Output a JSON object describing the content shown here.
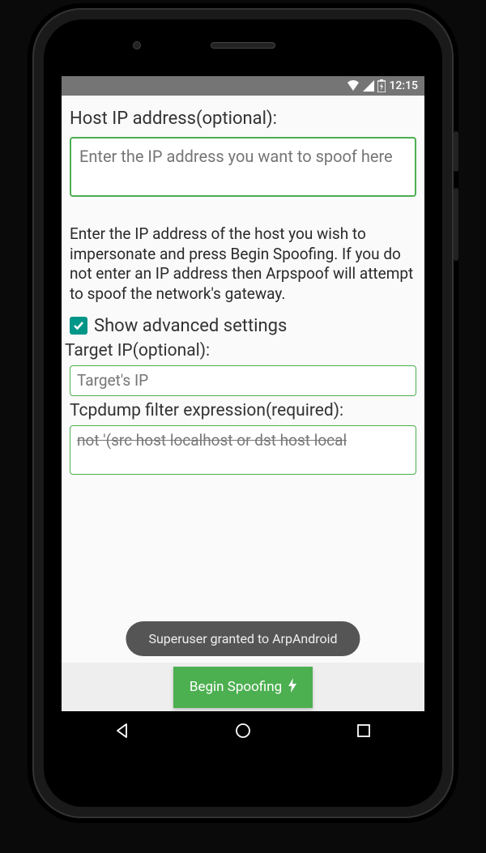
{
  "statusbar": {
    "time": "12:15"
  },
  "host": {
    "label": "Host IP address(optional):",
    "placeholder": "Enter the IP address you want to spoof here"
  },
  "description": "Enter the IP address of the host you wish to impersonate and press Begin Spoofing. If you do not enter an IP address then Arpspoof will attempt to spoof the network's gateway.",
  "advanced": {
    "checkbox_label": "Show advanced settings",
    "checked": true
  },
  "target": {
    "label": "Target IP(optional):",
    "placeholder": "Target's IP"
  },
  "filter": {
    "label": "Tcpdump filter expression(required):",
    "value": "not '(src host localhost or dst host local"
  },
  "toast": "Superuser granted to ArpAndroid",
  "button": {
    "label": "Begin Spoofing"
  }
}
